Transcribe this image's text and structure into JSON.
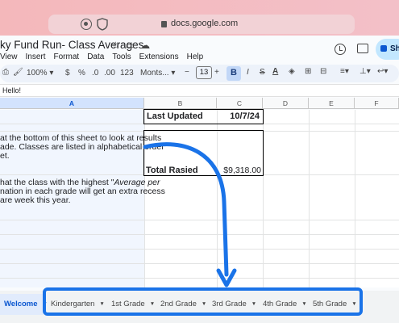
{
  "browser": {
    "url": "docs.google.com"
  },
  "doc": {
    "title": "ky Fund Run- Class Averages",
    "menu": [
      "View",
      "Insert",
      "Format",
      "Data",
      "Tools",
      "Extensions",
      "Help"
    ],
    "share_label": "Sh"
  },
  "toolbar": {
    "zoom": "100%",
    "currency": "$",
    "percent": "%",
    "dec_decrease": ".0",
    "dec_increase": ".00",
    "format_123": "123",
    "font": "Monts...",
    "font_size": "13",
    "bold": "B"
  },
  "formula_bar": {
    "value": "Hello!"
  },
  "columns": [
    "A",
    "B",
    "C",
    "D",
    "E",
    "F"
  ],
  "cells": {
    "last_updated_label": "Last Updated",
    "last_updated_value": "10/7/24",
    "total_label": "Total Rasied",
    "total_value": "$9,318.00",
    "para1_line1": "at the bottom of this sheet to look at results",
    "para1_line2": "ade. Classes are listed in alphabetical order",
    "para1_line3": "et.",
    "para2_line1": "hat the class with the highest \"",
    "para2_italic": "Average per",
    "para2_line2": "nation in each grade will get an extra recess",
    "para2_line3": "are week this year."
  },
  "tabs": [
    {
      "label": "Welcome",
      "active": true
    },
    {
      "label": "Kindergarten",
      "active": false
    },
    {
      "label": "1st Grade",
      "active": false
    },
    {
      "label": "2nd Grade",
      "active": false
    },
    {
      "label": "3rd Grade",
      "active": false
    },
    {
      "label": "4th Grade",
      "active": false
    },
    {
      "label": "5th Grade",
      "active": false
    }
  ],
  "colors": {
    "highlight": "#1a73e8",
    "accent": "#0b57d0"
  }
}
